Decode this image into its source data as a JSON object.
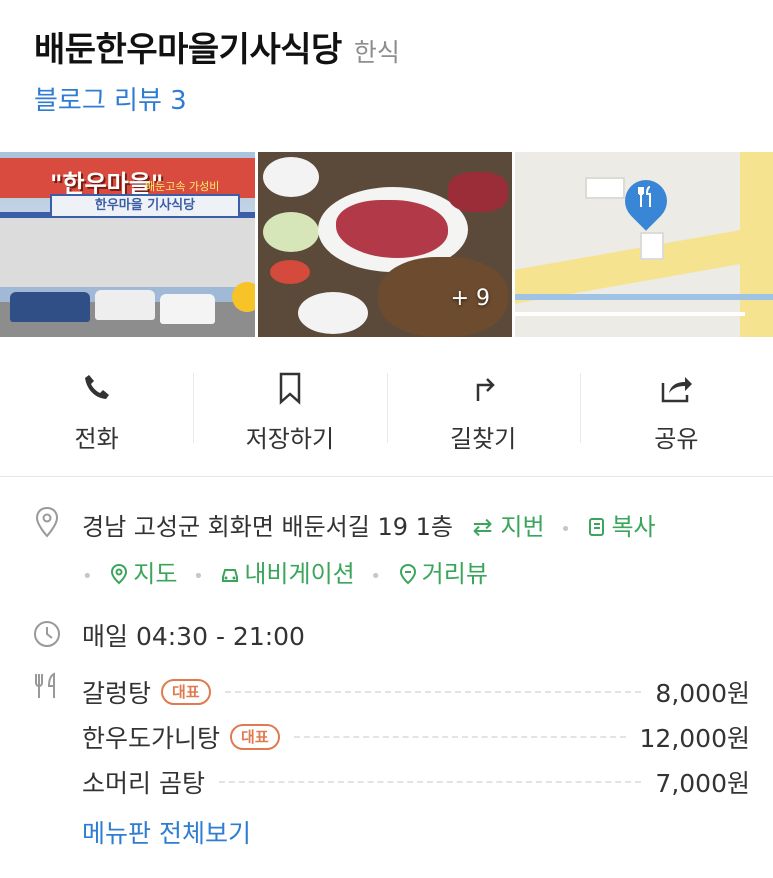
{
  "place": {
    "name": "배둔한우마을기사식당",
    "category": "한식",
    "blog_review": "블로그 리뷰 3"
  },
  "photos": {
    "sign_main": "\"한우마을\"",
    "sign_sub": "배둔고속 가성비",
    "bldg_sign": "한우마을 기사식당",
    "more_count": "+ 9"
  },
  "actions": [
    {
      "label": "전화",
      "icon": "phone-icon"
    },
    {
      "label": "저장하기",
      "icon": "bookmark-icon"
    },
    {
      "label": "길찾기",
      "icon": "directions-icon"
    },
    {
      "label": "공유",
      "icon": "share-icon"
    }
  ],
  "address": {
    "text": "경남 고성군 회화면 배둔서길 19 1층",
    "jibun_label": "지번",
    "copy_label": "복사",
    "map_label": "지도",
    "navi_label": "내비게이션",
    "street_label": "거리뷰"
  },
  "hours": {
    "text": "매일 04:30 - 21:00"
  },
  "menu": {
    "items": [
      {
        "name": "갈렁탕",
        "badge": "대표",
        "price": "8,000원"
      },
      {
        "name": "한우도가니탕",
        "badge": "대표",
        "price": "12,000원"
      },
      {
        "name": "소머리 곰탕",
        "badge": "",
        "price": "7,000원"
      }
    ],
    "view_all": "메뉴판 전체보기"
  },
  "colors": {
    "link_blue": "#2e7dd3",
    "action_green": "#3ba55c",
    "badge_orange": "#e07a4f",
    "pin_blue": "#3a86d6"
  }
}
